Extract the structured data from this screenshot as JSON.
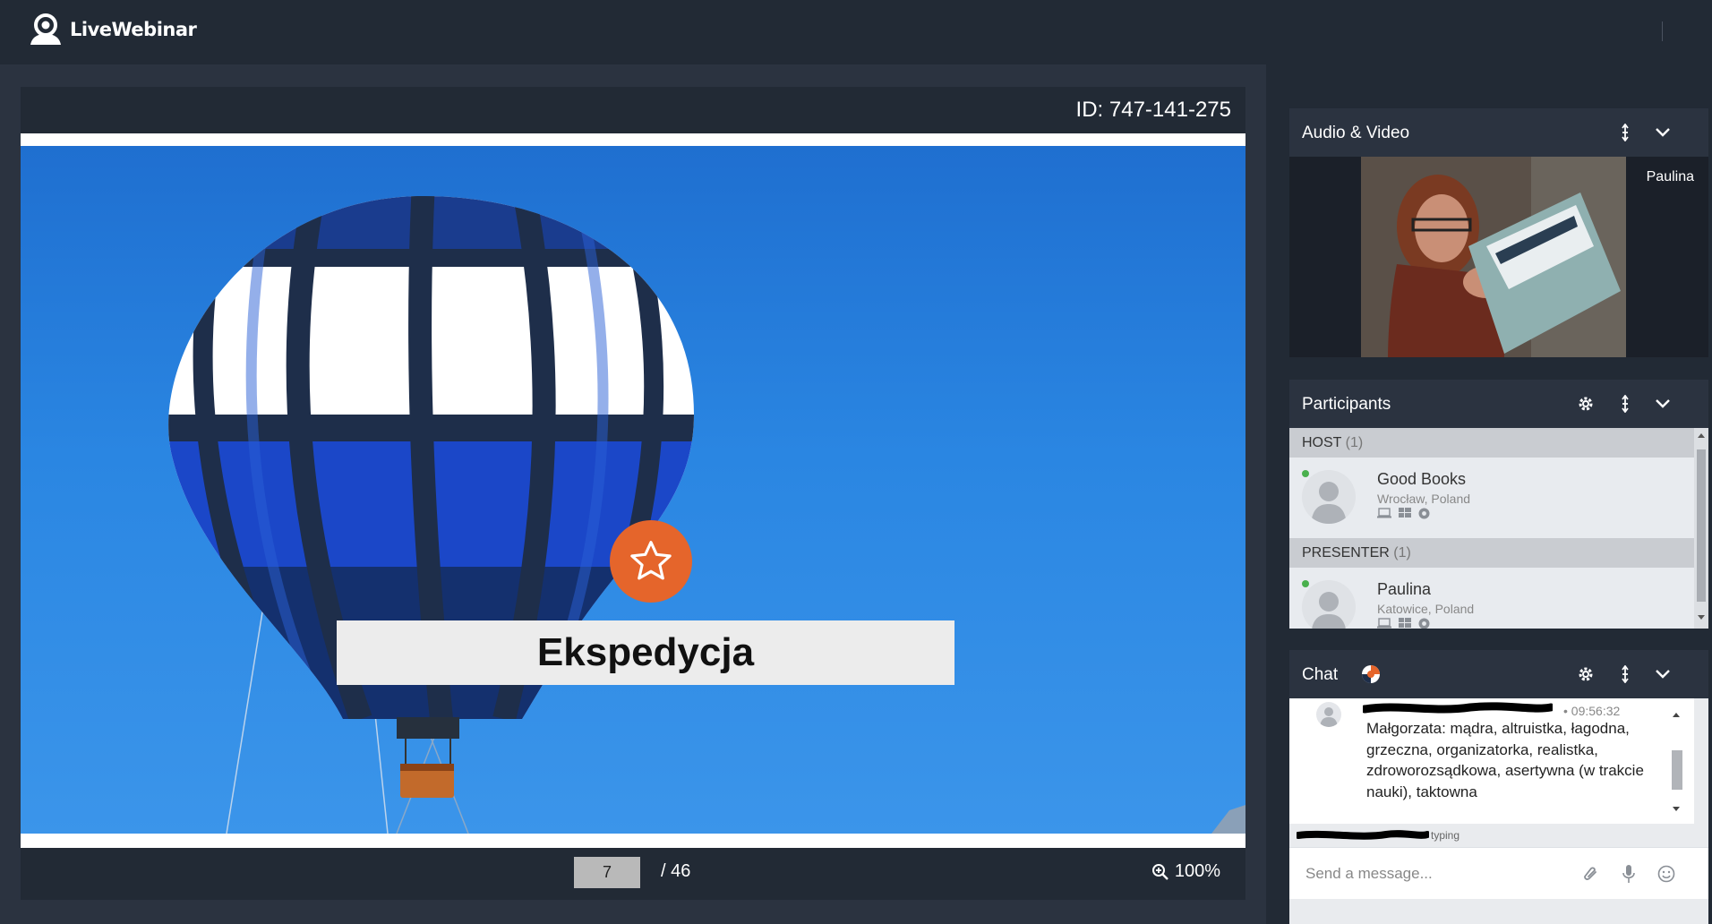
{
  "app": {
    "brand": "LiveWebinar"
  },
  "presentation": {
    "session_id": "ID: 747-141-275",
    "slide_title": "Ekspedycja",
    "current_page": "7",
    "total_pages": "/ 46",
    "zoom": "100%"
  },
  "audio_video": {
    "title": "Audio & Video",
    "presenter_name": "Paulina"
  },
  "participants": {
    "title": "Participants",
    "groups": [
      {
        "label": "HOST",
        "count": "(1)",
        "name": "Good Books",
        "location": "Wrocław, Poland"
      },
      {
        "label": "PRESENTER",
        "count": "(1)",
        "name": "Paulina",
        "location": "Katowice, Poland"
      }
    ]
  },
  "chat": {
    "title": "Chat",
    "message_time": "• 09:56:32",
    "message_text": "Małgorzata: mądra, altruistka, łagodna, grzeczna, organizatorka, realistka, zdroworozsądkowa, asertywna (w trakcie nauki), taktowna",
    "typing_label": "typing",
    "input_placeholder": "Send a message..."
  },
  "colors": {
    "accent": "#e5652b",
    "online": "#49b04d",
    "sky": "#2a86e2"
  }
}
